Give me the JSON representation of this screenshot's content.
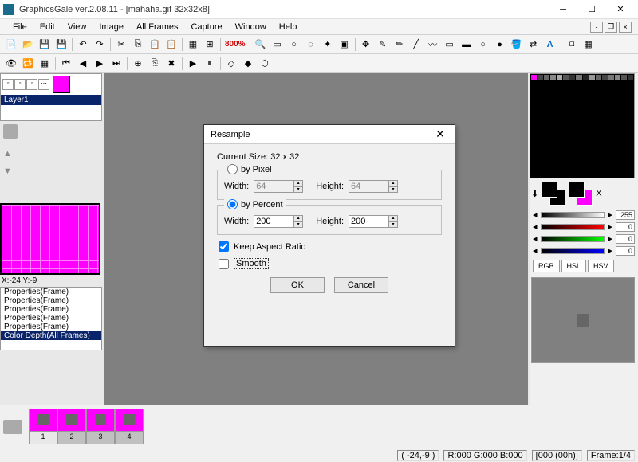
{
  "titlebar": {
    "title": "GraphicsGale ver.2.08.11 - [mahaha.gif 32x32x8]"
  },
  "menu": {
    "file": "File",
    "edit": "Edit",
    "view": "View",
    "image": "Image",
    "allframes": "All Frames",
    "capture": "Capture",
    "window": "Window",
    "help": "Help"
  },
  "toolbar": {
    "zoom": "800%"
  },
  "layer": {
    "name": "Layer1"
  },
  "coords": {
    "text": "X:-24 Y:-9"
  },
  "history": {
    "items": [
      "Properties(Frame)",
      "Properties(Frame)",
      "Properties(Frame)",
      "Properties(Frame)",
      "Properties(Frame)",
      "Color Depth(All Frames)"
    ]
  },
  "sliders": {
    "gray": "255",
    "r": "0",
    "g": "0",
    "b": "0"
  },
  "tabs": {
    "rgb": "RGB",
    "hsl": "HSL",
    "hsv": "HSV"
  },
  "frames": [
    "1",
    "2",
    "3",
    "4"
  ],
  "status": {
    "pos": "( -24,-9 )",
    "rgb": "R:000 G:000 B:000",
    "time": "[000 (00h)]",
    "frame": "Frame:1/4"
  },
  "dialog": {
    "title": "Resample",
    "current": "Current Size: 32 x 32",
    "by_pixel": "by Pixel",
    "by_percent": "by Percent",
    "width": "Width:",
    "height": "Height:",
    "px_w": "64",
    "px_h": "64",
    "pct_w": "200",
    "pct_h": "200",
    "keep": "Keep Aspect Ratio",
    "smooth": "Smooth",
    "ok": "OK",
    "cancel": "Cancel"
  }
}
